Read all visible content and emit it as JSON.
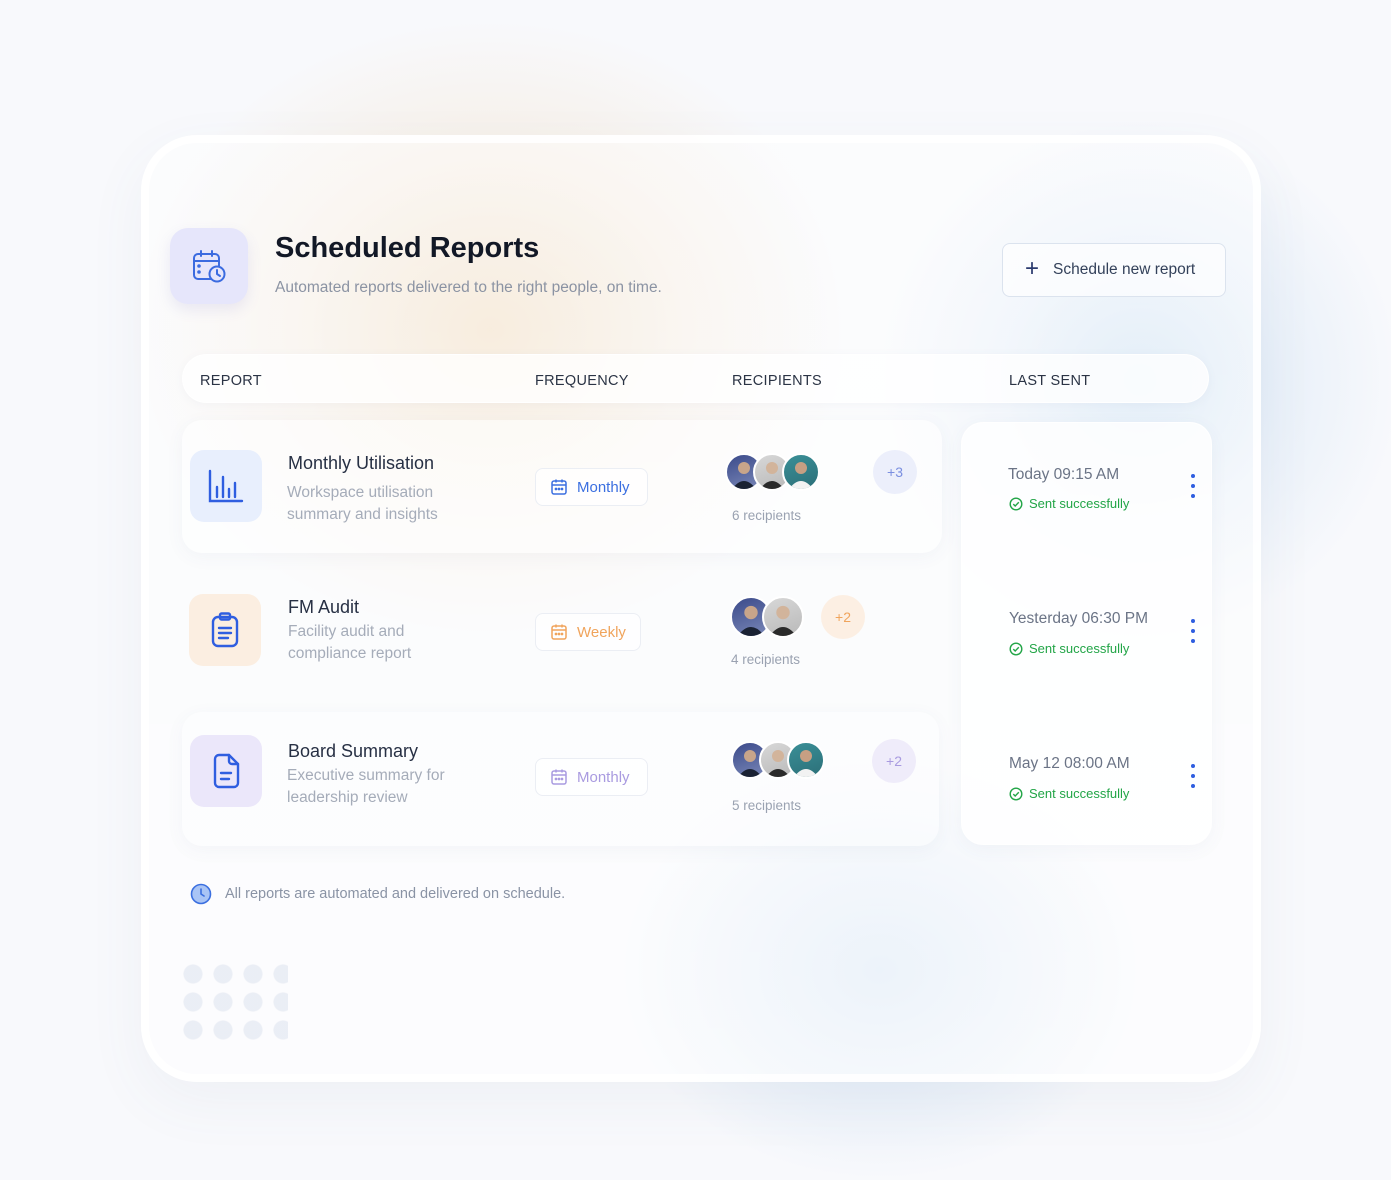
{
  "header": {
    "title": "Scheduled Reports",
    "subtitle": "Automated reports delivered to the right people, on time.",
    "icon": "calendar-clock-icon"
  },
  "actions": {
    "schedule_label": "Schedule new report",
    "schedule_icon": "plus-icon"
  },
  "table": {
    "columns": [
      "REPORT",
      "FREQUENCY",
      "RECIPIENTS",
      "LAST SENT"
    ]
  },
  "reports": [
    {
      "name": "Monthly Utilisation",
      "desc_line1": "Workspace utilisation",
      "desc_line2": "summary and insights",
      "icon": "bar-chart-icon",
      "frequency": "Monthly",
      "frequency_color": "#3b6fe0",
      "extra": "+3",
      "recipients": "6 recipients",
      "last_sent": "Today 09:15 AM",
      "status": "Sent successfully"
    },
    {
      "name": "FM Audit",
      "desc_line1": "Facility audit and",
      "desc_line2": "compliance report",
      "icon": "clipboard-icon",
      "frequency": "Weekly",
      "frequency_color": "#f0a45c",
      "extra": "+2",
      "recipients": "4 recipients",
      "last_sent": "Yesterday 06:30 PM",
      "status": "Sent successfully"
    },
    {
      "name": "Board Summary",
      "desc_line1": "Executive summary for",
      "desc_line2": "leadership review",
      "icon": "document-icon",
      "frequency": "Monthly",
      "frequency_color": "#a99be0",
      "extra": "+2",
      "recipients": "5 recipients",
      "last_sent": "May 12 08:00 AM",
      "status": "Sent successfully"
    }
  ],
  "footer": {
    "note": "All reports are automated and delivered on schedule.",
    "icon": "clock-icon"
  },
  "colors": {
    "accent": "#2f5ee0",
    "success": "#22a547"
  }
}
